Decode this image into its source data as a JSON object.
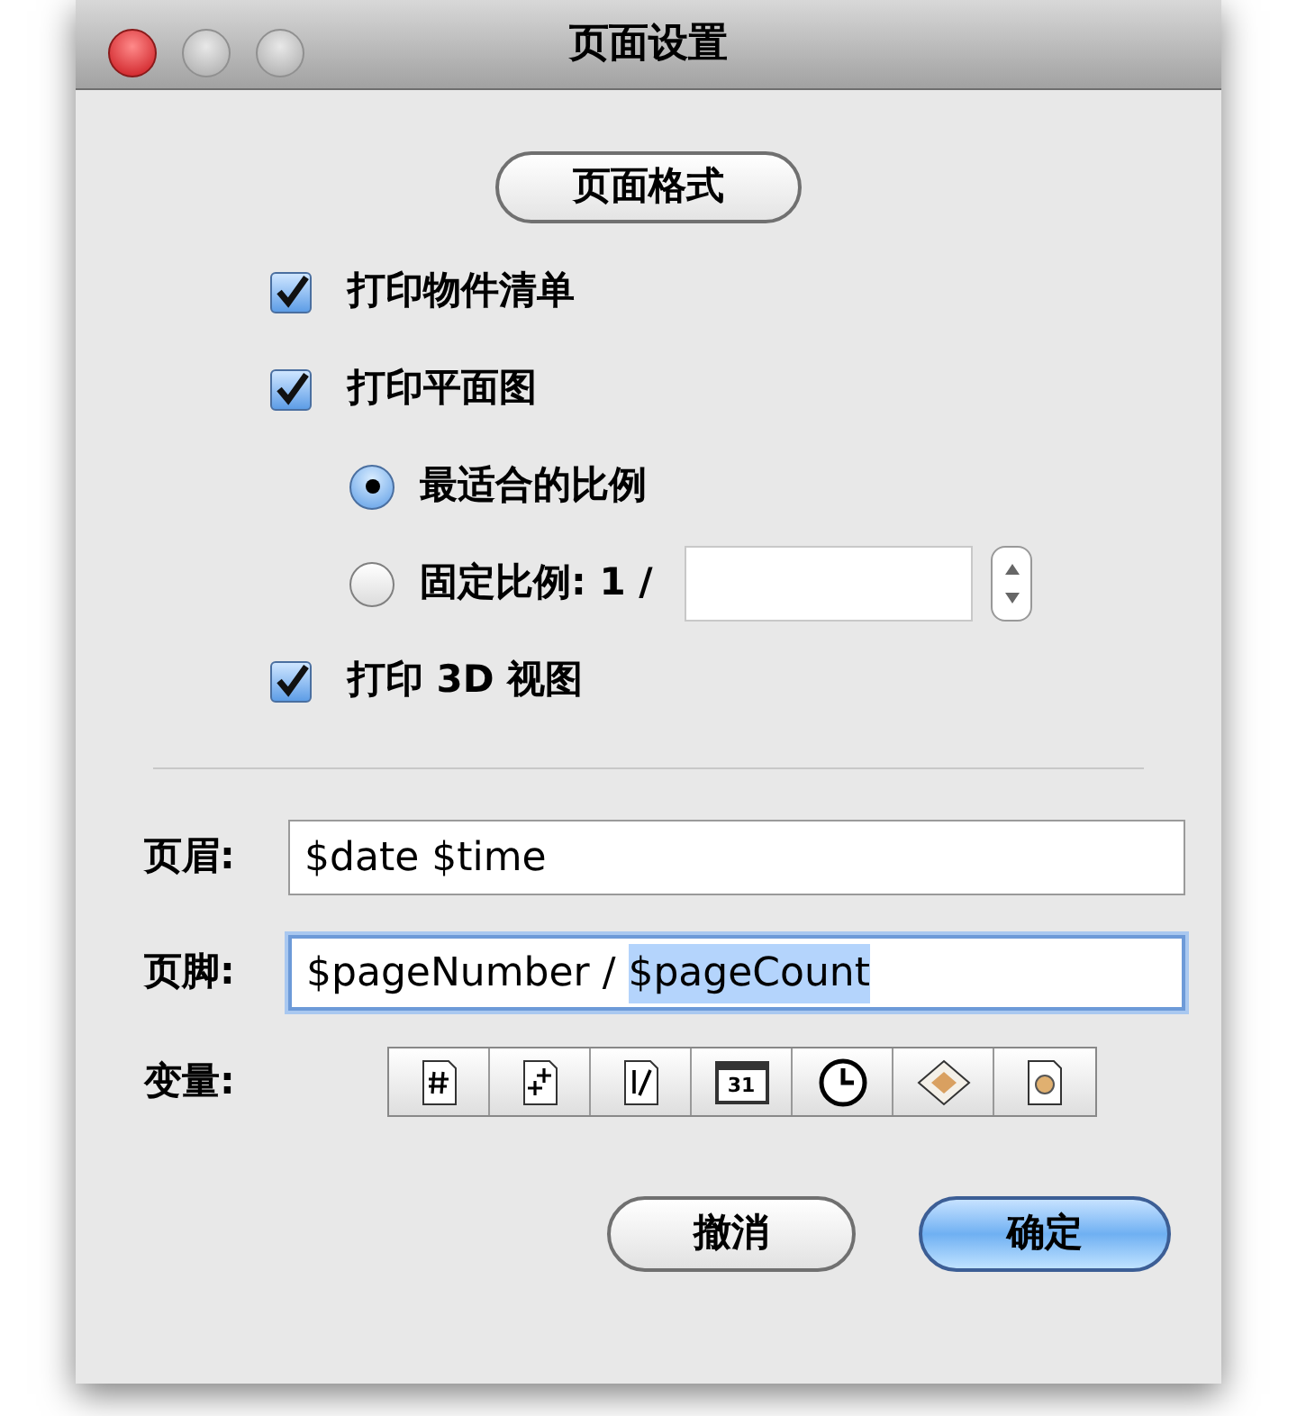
{
  "window": {
    "title": "页面设置"
  },
  "page_format_button": {
    "label": "页面格式"
  },
  "options": [
    {
      "kind": "checkbox",
      "label": "打印物件清单",
      "checked": true
    },
    {
      "kind": "checkbox",
      "label": "打印平面图",
      "checked": true
    },
    {
      "kind": "radio",
      "label": "最适合的比例",
      "selected": true
    },
    {
      "kind": "radio_field",
      "label": "固定比例: 1 /",
      "selected": false
    },
    {
      "kind": "checkbox",
      "label": "打印 3D 视图",
      "checked": true
    }
  ],
  "header_field": {
    "label": "页眉:",
    "parts": [
      {
        "text": "$date $time",
        "selected": false
      }
    ],
    "focused": false
  },
  "footer_field": {
    "label": "页脚:",
    "parts": [
      {
        "text": "$pageNumber / ",
        "selected": false
      },
      {
        "text": "$pageCount",
        "selected": true
      }
    ],
    "focused": true
  },
  "variables": {
    "label": "变量:",
    "buttons": [
      {
        "kind": "hash"
      },
      {
        "kind": "plus"
      },
      {
        "kind": "fraction"
      },
      {
        "kind": "calendar",
        "text": "31"
      },
      {
        "kind": "clock"
      },
      {
        "kind": "diamond"
      },
      {
        "kind": "page-gear"
      }
    ]
  },
  "buttons": [
    {
      "label": "撤消",
      "default": false
    },
    {
      "label": "确定",
      "default": true
    }
  ]
}
